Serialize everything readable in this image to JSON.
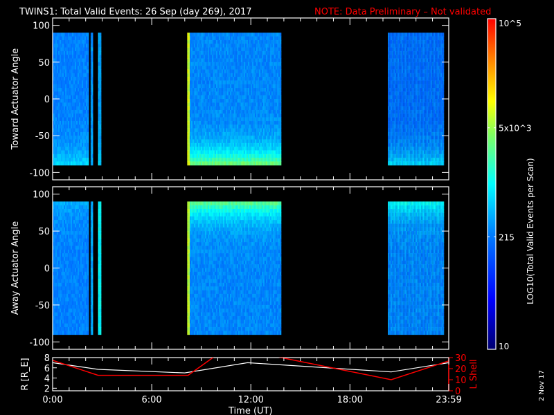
{
  "title": "TWINS1: Total Valid Events: 26 Sep (day 269), 2017",
  "note": "NOTE: Data Preliminary – Not validated",
  "date_stamp": "2 Nov 17",
  "colors": {
    "note": "#ff0000",
    "axes": "#ffffff",
    "lshell": "#ff0000",
    "r": "#ffffff"
  },
  "chart_data": [
    {
      "type": "heatmap",
      "name": "toward",
      "ylabel": "Toward Actuator Angle",
      "ylim": [
        -110,
        110
      ],
      "yticks": [
        100,
        50,
        0,
        -50,
        -100
      ],
      "data_ylim": [
        -90,
        90
      ],
      "blocks": [
        {
          "t0": 0.0,
          "t1": 2.2,
          "level": 0.35,
          "edge": 0.45
        },
        {
          "t0": 2.3,
          "t1": 2.45,
          "level": 0.38,
          "edge": 0.4
        },
        {
          "t0": 2.75,
          "t1": 2.95,
          "level": 0.4,
          "edge": 0.45
        },
        {
          "t0": 8.15,
          "t1": 8.3,
          "level": 0.72,
          "edge": 0.72
        },
        {
          "t0": 8.3,
          "t1": 13.85,
          "level": 0.36,
          "edge": 0.62
        },
        {
          "t0": 20.3,
          "t1": 23.7,
          "level": 0.33,
          "edge": 0.45
        }
      ]
    },
    {
      "type": "heatmap",
      "name": "away",
      "ylabel": "Away Actuator Angle",
      "ylim": [
        -110,
        110
      ],
      "yticks": [
        100,
        50,
        0,
        -50,
        -100
      ],
      "data_ylim": [
        -90,
        90
      ],
      "blocks": [
        {
          "t0": 0.0,
          "t1": 2.2,
          "level": 0.35,
          "edge": 0.4
        },
        {
          "t0": 2.3,
          "t1": 2.45,
          "level": 0.4,
          "edge": 0.4
        },
        {
          "t0": 2.75,
          "t1": 2.95,
          "level": 0.5,
          "edge": 0.5
        },
        {
          "t0": 8.15,
          "t1": 8.3,
          "level": 0.7,
          "edge": 0.7
        },
        {
          "t0": 8.3,
          "t1": 13.85,
          "level": 0.36,
          "edge": 0.6
        },
        {
          "t0": 20.3,
          "t1": 23.7,
          "level": 0.36,
          "edge": 0.5
        }
      ]
    },
    {
      "type": "line",
      "name": "orbit",
      "ylabel": "R [R_E]",
      "ylabel_right": "L Shell",
      "ylim": [
        1.5,
        8
      ],
      "yticks": [
        2,
        4,
        6,
        8
      ],
      "ylim_right": [
        0,
        30
      ],
      "yticks_right": [
        0,
        10,
        20,
        30
      ],
      "series": [
        {
          "name": "R",
          "x": [
            0,
            2.75,
            8,
            11.8,
            20.5,
            24
          ],
          "y": [
            7,
            5.7,
            5,
            7,
            5.2,
            7
          ]
        },
        {
          "name": "L Shell",
          "x": [
            0,
            2.75,
            8.2,
            9.8,
            13.5,
            20.5,
            24
          ],
          "y": [
            27.5,
            14,
            14,
            31,
            31,
            10,
            27
          ]
        }
      ]
    }
  ],
  "xaxis": {
    "label": "Time (UT)",
    "xlim": [
      0,
      23.983
    ],
    "ticks": [
      {
        "t": 0,
        "label": "0:00"
      },
      {
        "t": 6,
        "label": "6:00"
      },
      {
        "t": 12,
        "label": "12:00"
      },
      {
        "t": 18,
        "label": "18:00"
      },
      {
        "t": 23.983,
        "label": "23:59"
      }
    ]
  },
  "colorbar": {
    "label": "LOG10(Total Valid Events per Scan)",
    "ticks": [
      {
        "v": 1,
        "label": "10^5"
      },
      {
        "v": 0.67,
        "label": "5x10^3"
      },
      {
        "v": 0.34,
        "label": "215"
      },
      {
        "v": 0,
        "label": "10"
      }
    ]
  }
}
